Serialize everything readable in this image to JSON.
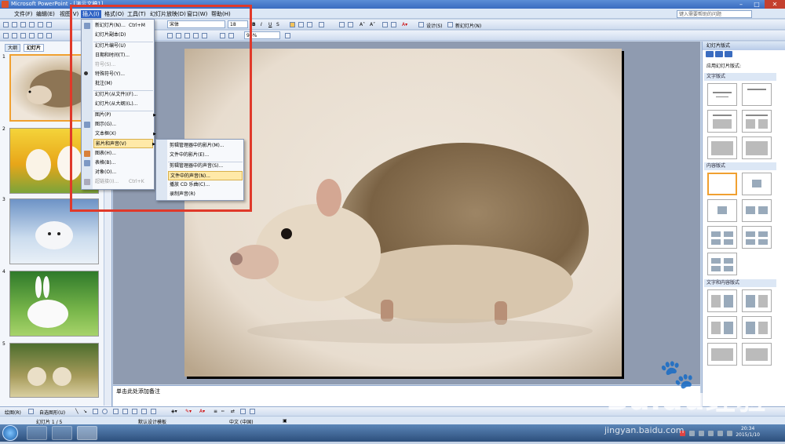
{
  "window": {
    "title": "Microsoft PowerPoint - [演示文稿1]"
  },
  "menubar": {
    "items": [
      "文件(F)",
      "编辑(E)",
      "视图(V)",
      "插入(I)",
      "格式(O)",
      "工具(T)",
      "幻灯片放映(D)",
      "窗口(W)",
      "帮助(H)"
    ],
    "help_placeholder": "键入需要帮助的问题"
  },
  "toolbar": {
    "font_name": "宋体",
    "font_size": "18",
    "design_label": "设计(S)",
    "new_slide_label": "新幻灯片(N)",
    "zoom": "96%"
  },
  "left_panel": {
    "tabs": [
      "大纲",
      "幻灯片"
    ],
    "slide_numbers": [
      "1",
      "2",
      "3",
      "4",
      "5"
    ]
  },
  "insert_menu": {
    "items": [
      {
        "label": "新幻灯片(N)...",
        "shortcut": "Ctrl+M",
        "disabled": false
      },
      {
        "label": "幻灯片副本(D)",
        "shortcut": "",
        "disabled": false
      },
      {
        "label": "幻灯片编号(U)",
        "shortcut": "",
        "disabled": false
      },
      {
        "label": "日期和时间(T)...",
        "shortcut": "",
        "disabled": false
      },
      {
        "label": "符号(S)...",
        "shortcut": "",
        "disabled": true
      },
      {
        "label": "特殊符号(Y)...",
        "shortcut": "",
        "disabled": false
      },
      {
        "label": "批注(M)",
        "shortcut": "",
        "disabled": false
      },
      {
        "label": "幻灯片(从文件)(F)...",
        "shortcut": "",
        "disabled": false
      },
      {
        "label": "幻灯片(从大纲)(L)...",
        "shortcut": "",
        "disabled": false
      },
      {
        "label": "图片(P)",
        "shortcut": "",
        "disabled": false
      },
      {
        "label": "图示(G)...",
        "shortcut": "",
        "disabled": false
      },
      {
        "label": "文本框(X)",
        "shortcut": "",
        "disabled": false
      },
      {
        "label": "影片和声音(V)",
        "shortcut": "",
        "disabled": false
      },
      {
        "label": "图表(H)...",
        "shortcut": "",
        "disabled": false
      },
      {
        "label": "表格(B)...",
        "shortcut": "",
        "disabled": false
      },
      {
        "label": "对象(O)...",
        "shortcut": "",
        "disabled": false
      },
      {
        "label": "超链接(I)...",
        "shortcut": "Ctrl+K",
        "disabled": true
      }
    ]
  },
  "media_submenu": {
    "items": [
      "剪辑管理器中的影片(M)...",
      "文件中的影片(E)...",
      "剪辑管理器中的声音(S)...",
      "文件中的声音(N)...",
      "播放 CD 乐曲(C)...",
      "录制声音(R)"
    ]
  },
  "notes": {
    "placeholder": "单击此处添加备注"
  },
  "task_pane": {
    "title": "幻灯片版式",
    "apply_label": "应用幻灯片版式:",
    "sections": [
      "文字版式",
      "内容版式",
      "文字和内容版式"
    ]
  },
  "drawing_toolbar": {
    "draw_label": "绘图(R)",
    "autoshapes_label": "自选图形(U)"
  },
  "statusbar": {
    "slide_info": "幻灯片 1 / 5",
    "template": "默认设计模板",
    "language": "中文 (中国)"
  },
  "taskbar": {
    "time": "20:34",
    "date": "2015/1/10"
  },
  "watermark": {
    "brand": "Baidu经验",
    "url": "jingyan.baidu.com"
  },
  "colors": {
    "accent": "#3a6cc0",
    "highlight": "#ffe9a8",
    "annotation_box": "#e0392a"
  }
}
